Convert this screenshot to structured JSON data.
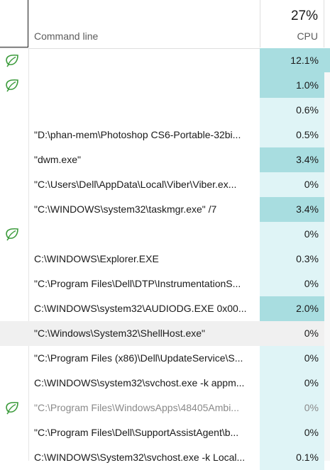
{
  "header": {
    "command_line_label": "Command line",
    "cpu_total": "27%",
    "cpu_label": "CPU"
  },
  "colors": {
    "heat_high": "#a8dde0",
    "heat_low": "#dff4f6",
    "leaf_icon": "#3c9b3c"
  },
  "rows": [
    {
      "icon": "leaf-icon",
      "command": "",
      "cpu": "12.1%",
      "heat": "high",
      "dim": false,
      "selected": false
    },
    {
      "icon": "leaf-icon",
      "command": "",
      "cpu": "1.0%",
      "heat": "high",
      "dim": false,
      "selected": false
    },
    {
      "icon": "",
      "command": "",
      "cpu": "0.6%",
      "heat": "low",
      "dim": false,
      "selected": false
    },
    {
      "icon": "",
      "command": "\"D:\\phan-mem\\Photoshop CS6-Portable-32bi...",
      "cpu": "0.5%",
      "heat": "low",
      "dim": false,
      "selected": false
    },
    {
      "icon": "",
      "command": "\"dwm.exe\"",
      "cpu": "3.4%",
      "heat": "high",
      "dim": false,
      "selected": false
    },
    {
      "icon": "",
      "command": "\"C:\\Users\\Dell\\AppData\\Local\\Viber\\Viber.ex...",
      "cpu": "0%",
      "heat": "low",
      "dim": false,
      "selected": false
    },
    {
      "icon": "",
      "command": "\"C:\\WINDOWS\\system32\\taskmgr.exe\" /7",
      "cpu": "3.4%",
      "heat": "high",
      "dim": false,
      "selected": false
    },
    {
      "icon": "leaf-icon",
      "command": "",
      "cpu": "0%",
      "heat": "low",
      "dim": false,
      "selected": false
    },
    {
      "icon": "",
      "command": "C:\\WINDOWS\\Explorer.EXE",
      "cpu": "0.3%",
      "heat": "low",
      "dim": false,
      "selected": false
    },
    {
      "icon": "",
      "command": "\"C:\\Program Files\\Dell\\DTP\\InstrumentationS...",
      "cpu": "0%",
      "heat": "low",
      "dim": false,
      "selected": false
    },
    {
      "icon": "",
      "command": "C:\\WINDOWS\\system32\\AUDIODG.EXE 0x00...",
      "cpu": "2.0%",
      "heat": "high",
      "dim": false,
      "selected": false
    },
    {
      "icon": "",
      "command": "\"C:\\Windows\\System32\\ShellHost.exe\"",
      "cpu": "0%",
      "heat": "none",
      "dim": false,
      "selected": true
    },
    {
      "icon": "",
      "command": "\"C:\\Program Files (x86)\\Dell\\UpdateService\\S...",
      "cpu": "0%",
      "heat": "low",
      "dim": false,
      "selected": false
    },
    {
      "icon": "",
      "command": "C:\\WINDOWS\\system32\\svchost.exe -k appm...",
      "cpu": "0%",
      "heat": "low",
      "dim": false,
      "selected": false
    },
    {
      "icon": "leaf-icon",
      "command": "\"C:\\Program Files\\WindowsApps\\48405Ambi...",
      "cpu": "0%",
      "heat": "low",
      "dim": true,
      "selected": false
    },
    {
      "icon": "",
      "command": "\"C:\\Program Files\\Dell\\SupportAssistAgent\\b...",
      "cpu": "0%",
      "heat": "low",
      "dim": false,
      "selected": false
    },
    {
      "icon": "",
      "command": "C:\\WINDOWS\\System32\\svchost.exe -k Local...",
      "cpu": "0.1%",
      "heat": "low",
      "dim": false,
      "selected": false
    }
  ]
}
